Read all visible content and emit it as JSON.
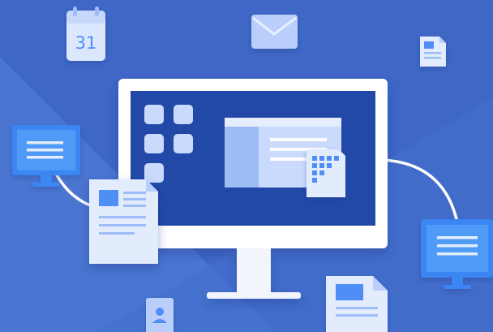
{
  "calendar": {
    "day_number": "31"
  },
  "colors": {
    "background": "#3f67c6",
    "background_band": "#4a75d1",
    "monitor_frame": "#ffffff",
    "monitor_screen": "#2448a8",
    "tile_light": "#c9dafc",
    "accent_blue": "#4f8ef5",
    "paper": "#e3ecfd",
    "connector": "#ffffff"
  },
  "icons": [
    "calendar-icon",
    "envelope-icon",
    "document-icon",
    "desktop-monitor-icon",
    "app-grid-icon",
    "window-panel-icon",
    "contact-card-icon",
    "image-document-icon"
  ]
}
